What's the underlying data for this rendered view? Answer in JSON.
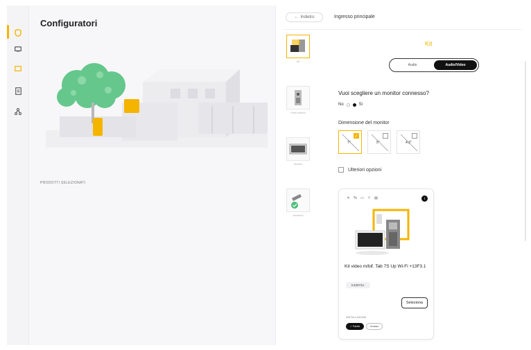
{
  "app": {
    "title": "Configuratori",
    "selected_products_label": "PRODOTTI SELEZIONATI"
  },
  "rail": {
    "icons": [
      "shield-icon",
      "monitor-icon",
      "panel-icon",
      "document-icon",
      "network-icon"
    ],
    "accent": "#f5b400"
  },
  "header": {
    "back_label": "Indietro",
    "breadcrumb": "Ingresso principale"
  },
  "thumbs": [
    {
      "caption": "Kit"
    },
    {
      "caption": "Posto esterno"
    },
    {
      "caption": "Monitor"
    },
    {
      "caption": "Accessori"
    }
  ],
  "kit": {
    "title": "Kit",
    "toggle": {
      "options": [
        "Audio",
        "Audio/Video"
      ],
      "selected": "Audio/Video"
    }
  },
  "monitor_question": {
    "label": "Vuoi scegliere un monitor connesso?",
    "no_label": "No",
    "yes_label": "Sì",
    "selected": "Sì"
  },
  "monitor_size": {
    "label": "Dimensione del monitor",
    "options": [
      "7\"",
      "5\"",
      "4.3\""
    ],
    "selected": "7\""
  },
  "more_options_label": "Ulteriori opzioni",
  "product": {
    "features": [
      "✕",
      "%",
      "▭",
      "⌔",
      "▤"
    ],
    "name": "Kit video m/bif. Tab 7S Up Wi-Fi +13F3.1",
    "code": "K40973A",
    "select_label": "Seleziona",
    "install_label": "INSTALLAZIONE",
    "install_options": [
      "✓ Parete",
      "Incasso"
    ],
    "install_selected": "✓ Parete"
  }
}
